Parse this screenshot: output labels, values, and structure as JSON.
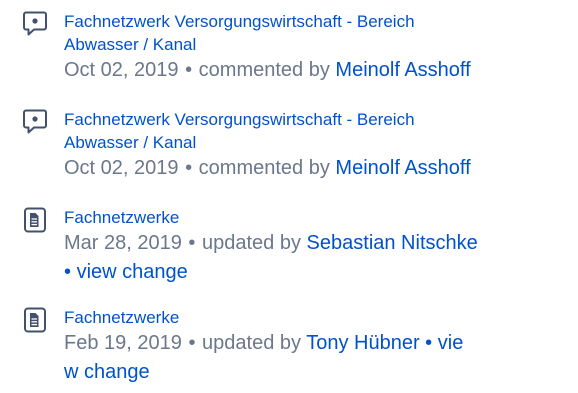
{
  "feed": {
    "items": [
      {
        "icon": "comment-icon",
        "title_line1": "Fachnetzwerk Versorgungswirtschaft - Bereich",
        "title_line2": "Abwasser / Kanal",
        "date": "Oct 02, 2019",
        "separator": "•",
        "action": "commented by",
        "user": "Meinolf Asshoff"
      },
      {
        "icon": "comment-icon",
        "title_line1": "Fachnetzwerk Versorgungswirtschaft - Bereich",
        "title_line2": "Abwasser / Kanal",
        "date": "Oct 02, 2019",
        "separator": "•",
        "action": "commented by",
        "user": "Meinolf Asshoff"
      },
      {
        "icon": "page-icon",
        "title": "Fachnetzwerke",
        "date": "Mar 28, 2019",
        "separator": "•",
        "action": "updated by",
        "user": "Sebastian Nitschke",
        "separator2": "•",
        "link": "view change"
      },
      {
        "icon": "page-icon",
        "title": "Fachnetzwerke",
        "date": "Feb 19, 2019",
        "separator": "•",
        "action": "updated by",
        "user": "Tony Hübner",
        "separator2": "•",
        "link_part1": "vie",
        "link_part2": "w change"
      }
    ]
  }
}
